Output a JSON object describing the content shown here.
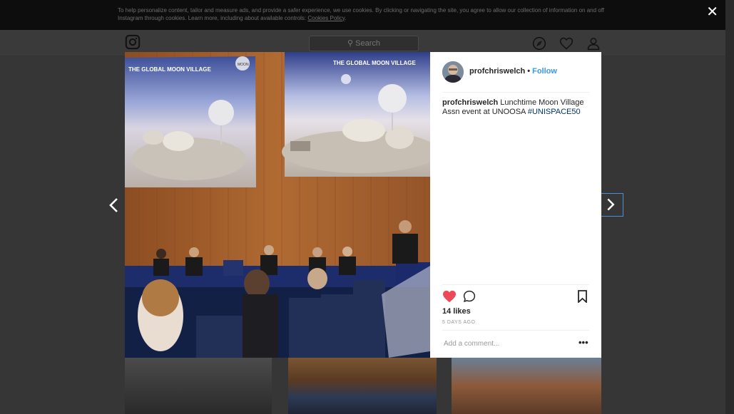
{
  "cookie_banner": {
    "text": "To help personalize content, tailor and measure ads, and provide a safer experience, we use cookies. By clicking or navigating the site, you agree to allow our collection of information on and off Instagram through cookies. Learn more, including about available controls: ",
    "link": "Cookies Policy",
    "end": "."
  },
  "close_label": "✕",
  "header": {
    "search_placeholder": "Search"
  },
  "post": {
    "username": "profchriswelch",
    "follow_label": "Follow",
    "caption_text": " Lunchtime Moon Village Assn event at UNOOSA ",
    "hashtag": "#UNISPACE50",
    "likes": "14 likes",
    "time_ago": "5 DAYS AGO",
    "comment_placeholder": "Add a comment...",
    "more_label": "•••",
    "photo_slide_titles": [
      "THE GLOBAL MOON VILLAGE",
      "THE GLOBAL MOON VILLAGE"
    ],
    "photo_slide_logo": "MOON"
  },
  "colors": {
    "accent": "#3897f0",
    "like": "#ed4956",
    "hashtag": "#003569"
  }
}
